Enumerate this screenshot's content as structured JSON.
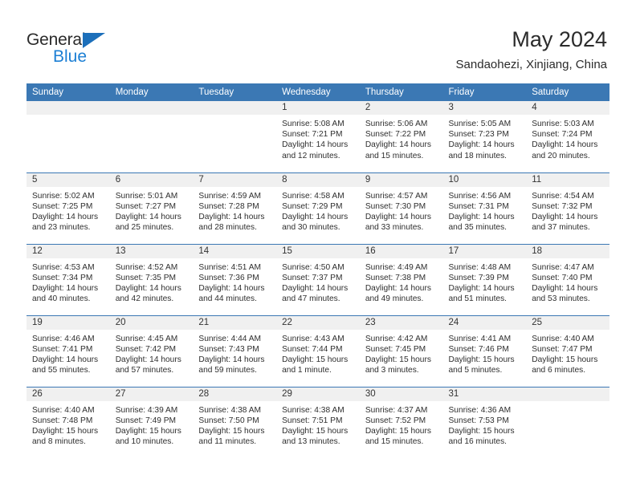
{
  "brand": {
    "name_part1": "General",
    "name_part2": "Blue",
    "triangle_icon": "triangle-icon",
    "color_primary": "#1c7fd4",
    "color_dark": "#2b2b2b"
  },
  "header": {
    "title": "May 2024",
    "location": "Sandaohezi, Xinjiang, China"
  },
  "theme": {
    "header_bg": "#3b78b4",
    "daynum_band_bg": "#f0f0f0",
    "cell_bg": "#ffffff",
    "divider": "#3b78b4"
  },
  "weekdays": [
    "Sunday",
    "Monday",
    "Tuesday",
    "Wednesday",
    "Thursday",
    "Friday",
    "Saturday"
  ],
  "weeks": [
    [
      {
        "day": "",
        "sunrise": "",
        "sunset": "",
        "daylight1": "",
        "daylight2": "",
        "empty": true
      },
      {
        "day": "",
        "sunrise": "",
        "sunset": "",
        "daylight1": "",
        "daylight2": "",
        "empty": true
      },
      {
        "day": "",
        "sunrise": "",
        "sunset": "",
        "daylight1": "",
        "daylight2": "",
        "empty": true
      },
      {
        "day": "1",
        "sunrise": "Sunrise: 5:08 AM",
        "sunset": "Sunset: 7:21 PM",
        "daylight1": "Daylight: 14 hours",
        "daylight2": "and 12 minutes."
      },
      {
        "day": "2",
        "sunrise": "Sunrise: 5:06 AM",
        "sunset": "Sunset: 7:22 PM",
        "daylight1": "Daylight: 14 hours",
        "daylight2": "and 15 minutes."
      },
      {
        "day": "3",
        "sunrise": "Sunrise: 5:05 AM",
        "sunset": "Sunset: 7:23 PM",
        "daylight1": "Daylight: 14 hours",
        "daylight2": "and 18 minutes."
      },
      {
        "day": "4",
        "sunrise": "Sunrise: 5:03 AM",
        "sunset": "Sunset: 7:24 PM",
        "daylight1": "Daylight: 14 hours",
        "daylight2": "and 20 minutes."
      }
    ],
    [
      {
        "day": "5",
        "sunrise": "Sunrise: 5:02 AM",
        "sunset": "Sunset: 7:25 PM",
        "daylight1": "Daylight: 14 hours",
        "daylight2": "and 23 minutes."
      },
      {
        "day": "6",
        "sunrise": "Sunrise: 5:01 AM",
        "sunset": "Sunset: 7:27 PM",
        "daylight1": "Daylight: 14 hours",
        "daylight2": "and 25 minutes."
      },
      {
        "day": "7",
        "sunrise": "Sunrise: 4:59 AM",
        "sunset": "Sunset: 7:28 PM",
        "daylight1": "Daylight: 14 hours",
        "daylight2": "and 28 minutes."
      },
      {
        "day": "8",
        "sunrise": "Sunrise: 4:58 AM",
        "sunset": "Sunset: 7:29 PM",
        "daylight1": "Daylight: 14 hours",
        "daylight2": "and 30 minutes."
      },
      {
        "day": "9",
        "sunrise": "Sunrise: 4:57 AM",
        "sunset": "Sunset: 7:30 PM",
        "daylight1": "Daylight: 14 hours",
        "daylight2": "and 33 minutes."
      },
      {
        "day": "10",
        "sunrise": "Sunrise: 4:56 AM",
        "sunset": "Sunset: 7:31 PM",
        "daylight1": "Daylight: 14 hours",
        "daylight2": "and 35 minutes."
      },
      {
        "day": "11",
        "sunrise": "Sunrise: 4:54 AM",
        "sunset": "Sunset: 7:32 PM",
        "daylight1": "Daylight: 14 hours",
        "daylight2": "and 37 minutes."
      }
    ],
    [
      {
        "day": "12",
        "sunrise": "Sunrise: 4:53 AM",
        "sunset": "Sunset: 7:34 PM",
        "daylight1": "Daylight: 14 hours",
        "daylight2": "and 40 minutes."
      },
      {
        "day": "13",
        "sunrise": "Sunrise: 4:52 AM",
        "sunset": "Sunset: 7:35 PM",
        "daylight1": "Daylight: 14 hours",
        "daylight2": "and 42 minutes."
      },
      {
        "day": "14",
        "sunrise": "Sunrise: 4:51 AM",
        "sunset": "Sunset: 7:36 PM",
        "daylight1": "Daylight: 14 hours",
        "daylight2": "and 44 minutes."
      },
      {
        "day": "15",
        "sunrise": "Sunrise: 4:50 AM",
        "sunset": "Sunset: 7:37 PM",
        "daylight1": "Daylight: 14 hours",
        "daylight2": "and 47 minutes."
      },
      {
        "day": "16",
        "sunrise": "Sunrise: 4:49 AM",
        "sunset": "Sunset: 7:38 PM",
        "daylight1": "Daylight: 14 hours",
        "daylight2": "and 49 minutes."
      },
      {
        "day": "17",
        "sunrise": "Sunrise: 4:48 AM",
        "sunset": "Sunset: 7:39 PM",
        "daylight1": "Daylight: 14 hours",
        "daylight2": "and 51 minutes."
      },
      {
        "day": "18",
        "sunrise": "Sunrise: 4:47 AM",
        "sunset": "Sunset: 7:40 PM",
        "daylight1": "Daylight: 14 hours",
        "daylight2": "and 53 minutes."
      }
    ],
    [
      {
        "day": "19",
        "sunrise": "Sunrise: 4:46 AM",
        "sunset": "Sunset: 7:41 PM",
        "daylight1": "Daylight: 14 hours",
        "daylight2": "and 55 minutes."
      },
      {
        "day": "20",
        "sunrise": "Sunrise: 4:45 AM",
        "sunset": "Sunset: 7:42 PM",
        "daylight1": "Daylight: 14 hours",
        "daylight2": "and 57 minutes."
      },
      {
        "day": "21",
        "sunrise": "Sunrise: 4:44 AM",
        "sunset": "Sunset: 7:43 PM",
        "daylight1": "Daylight: 14 hours",
        "daylight2": "and 59 minutes."
      },
      {
        "day": "22",
        "sunrise": "Sunrise: 4:43 AM",
        "sunset": "Sunset: 7:44 PM",
        "daylight1": "Daylight: 15 hours",
        "daylight2": "and 1 minute."
      },
      {
        "day": "23",
        "sunrise": "Sunrise: 4:42 AM",
        "sunset": "Sunset: 7:45 PM",
        "daylight1": "Daylight: 15 hours",
        "daylight2": "and 3 minutes."
      },
      {
        "day": "24",
        "sunrise": "Sunrise: 4:41 AM",
        "sunset": "Sunset: 7:46 PM",
        "daylight1": "Daylight: 15 hours",
        "daylight2": "and 5 minutes."
      },
      {
        "day": "25",
        "sunrise": "Sunrise: 4:40 AM",
        "sunset": "Sunset: 7:47 PM",
        "daylight1": "Daylight: 15 hours",
        "daylight2": "and 6 minutes."
      }
    ],
    [
      {
        "day": "26",
        "sunrise": "Sunrise: 4:40 AM",
        "sunset": "Sunset: 7:48 PM",
        "daylight1": "Daylight: 15 hours",
        "daylight2": "and 8 minutes."
      },
      {
        "day": "27",
        "sunrise": "Sunrise: 4:39 AM",
        "sunset": "Sunset: 7:49 PM",
        "daylight1": "Daylight: 15 hours",
        "daylight2": "and 10 minutes."
      },
      {
        "day": "28",
        "sunrise": "Sunrise: 4:38 AM",
        "sunset": "Sunset: 7:50 PM",
        "daylight1": "Daylight: 15 hours",
        "daylight2": "and 11 minutes."
      },
      {
        "day": "29",
        "sunrise": "Sunrise: 4:38 AM",
        "sunset": "Sunset: 7:51 PM",
        "daylight1": "Daylight: 15 hours",
        "daylight2": "and 13 minutes."
      },
      {
        "day": "30",
        "sunrise": "Sunrise: 4:37 AM",
        "sunset": "Sunset: 7:52 PM",
        "daylight1": "Daylight: 15 hours",
        "daylight2": "and 15 minutes."
      },
      {
        "day": "31",
        "sunrise": "Sunrise: 4:36 AM",
        "sunset": "Sunset: 7:53 PM",
        "daylight1": "Daylight: 15 hours",
        "daylight2": "and 16 minutes."
      },
      {
        "day": "",
        "sunrise": "",
        "sunset": "",
        "daylight1": "",
        "daylight2": "",
        "empty": true
      }
    ]
  ]
}
